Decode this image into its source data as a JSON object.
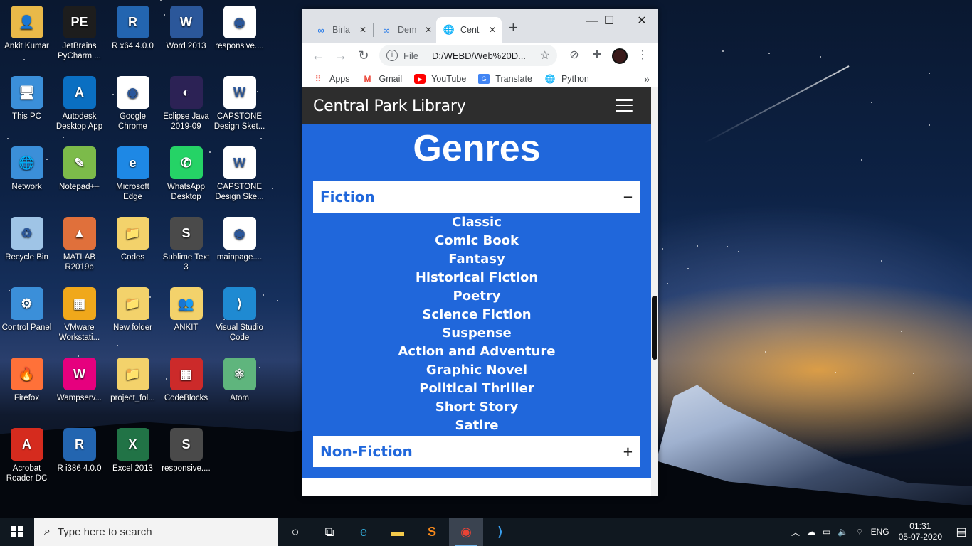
{
  "desktop": {
    "icons": [
      {
        "label": "Ankit Kumar",
        "color": "#e9b949",
        "glyph": "👤"
      },
      {
        "label": "JetBrains PyCharm ...",
        "color": "#1d1d1d",
        "glyph": "PE"
      },
      {
        "label": "R x64 4.0.0",
        "color": "#2365b0",
        "glyph": "R"
      },
      {
        "label": "Word 2013",
        "color": "#2b579a",
        "glyph": "W"
      },
      {
        "label": "responsive....",
        "color": "#ffffff",
        "glyph": "◉"
      },
      {
        "label": "This PC",
        "color": "#3b8fd9",
        "glyph": "🖥"
      },
      {
        "label": "Autodesk Desktop App",
        "color": "#0a6fc2",
        "glyph": "A"
      },
      {
        "label": "Google Chrome",
        "color": "#ffffff",
        "glyph": "◉"
      },
      {
        "label": "Eclipse Java 2019-09",
        "color": "#2c2255",
        "glyph": "◐"
      },
      {
        "label": "CAPSTONE Design Sket...",
        "color": "#ffffff",
        "glyph": "W"
      },
      {
        "label": "Network",
        "color": "#3b8fd9",
        "glyph": "🌐"
      },
      {
        "label": "Notepad++",
        "color": "#7cbb4a",
        "glyph": "✎"
      },
      {
        "label": "Microsoft Edge",
        "color": "#1e88e5",
        "glyph": "e"
      },
      {
        "label": "WhatsApp Desktop",
        "color": "#25d366",
        "glyph": "✆"
      },
      {
        "label": "CAPSTONE Design Ske...",
        "color": "#ffffff",
        "glyph": "W"
      },
      {
        "label": "Recycle Bin",
        "color": "#9fc4e6",
        "glyph": "♻"
      },
      {
        "label": "MATLAB R2019b",
        "color": "#e0703b",
        "glyph": "▲"
      },
      {
        "label": "Codes",
        "color": "#f3d26b",
        "glyph": "📁"
      },
      {
        "label": "Sublime Text 3",
        "color": "#4a4a4a",
        "glyph": "S"
      },
      {
        "label": "mainpage....",
        "color": "#ffffff",
        "glyph": "◉"
      },
      {
        "label": "Control Panel",
        "color": "#3b8fd9",
        "glyph": "⚙"
      },
      {
        "label": "VMware Workstati...",
        "color": "#f0a81b",
        "glyph": "▦"
      },
      {
        "label": "New folder",
        "color": "#f3d26b",
        "glyph": "📁"
      },
      {
        "label": "ANKIT",
        "color": "#f3d26b",
        "glyph": "👥"
      },
      {
        "label": "Visual Studio Code",
        "color": "#1f8ad2",
        "glyph": "⟩"
      },
      {
        "label": "Firefox",
        "color": "#ff7139",
        "glyph": "🔥"
      },
      {
        "label": "Wampserv...",
        "color": "#e6007e",
        "glyph": "W"
      },
      {
        "label": "project_fol...",
        "color": "#f3d26b",
        "glyph": "📁"
      },
      {
        "label": "CodeBlocks",
        "color": "#cc2a2a",
        "glyph": "▦"
      },
      {
        "label": "Atom",
        "color": "#5fb57d",
        "glyph": "⚛"
      },
      {
        "label": "Acrobat Reader DC",
        "color": "#d52b1e",
        "glyph": "A"
      },
      {
        "label": "R i386 4.0.0",
        "color": "#2365b0",
        "glyph": "R"
      },
      {
        "label": "Excel 2013",
        "color": "#217346",
        "glyph": "X"
      },
      {
        "label": "responsive....",
        "color": "#4a4a4a",
        "glyph": "S"
      }
    ]
  },
  "browser": {
    "tabs": [
      {
        "title": "Birla",
        "icon": "∞"
      },
      {
        "title": "Dem",
        "icon": "∞"
      },
      {
        "title": "Cent",
        "icon": "🌐"
      }
    ],
    "omnibox": {
      "prefix": "File",
      "url": "D:/WEBD/Web%20D..."
    },
    "bookmarks": [
      {
        "label": "Apps",
        "icon": "apps-icon"
      },
      {
        "label": "Gmail",
        "icon": "gmail-icon"
      },
      {
        "label": "YouTube",
        "icon": "youtube-icon"
      },
      {
        "label": "Translate",
        "icon": "translate-icon"
      },
      {
        "label": "Python",
        "icon": "globe-icon"
      }
    ]
  },
  "page": {
    "brand": "Central Park Library",
    "heading": "Genres",
    "accent": "#2067db",
    "fiction": {
      "title": "Fiction",
      "toggle": "−",
      "items": [
        "Classic",
        "Comic Book",
        "Fantasy",
        "Historical Fiction",
        "Poetry",
        "Science Fiction",
        "Suspense",
        "Action and Adventure",
        "Graphic Novel",
        "Political Thriller",
        "Short Story",
        "Satire"
      ]
    },
    "nonfiction": {
      "title": "Non-Fiction",
      "toggle": "+"
    }
  },
  "taskbar": {
    "search_placeholder": "Type here to search",
    "language": "ENG",
    "time": "01:31",
    "date": "05-07-2020"
  }
}
